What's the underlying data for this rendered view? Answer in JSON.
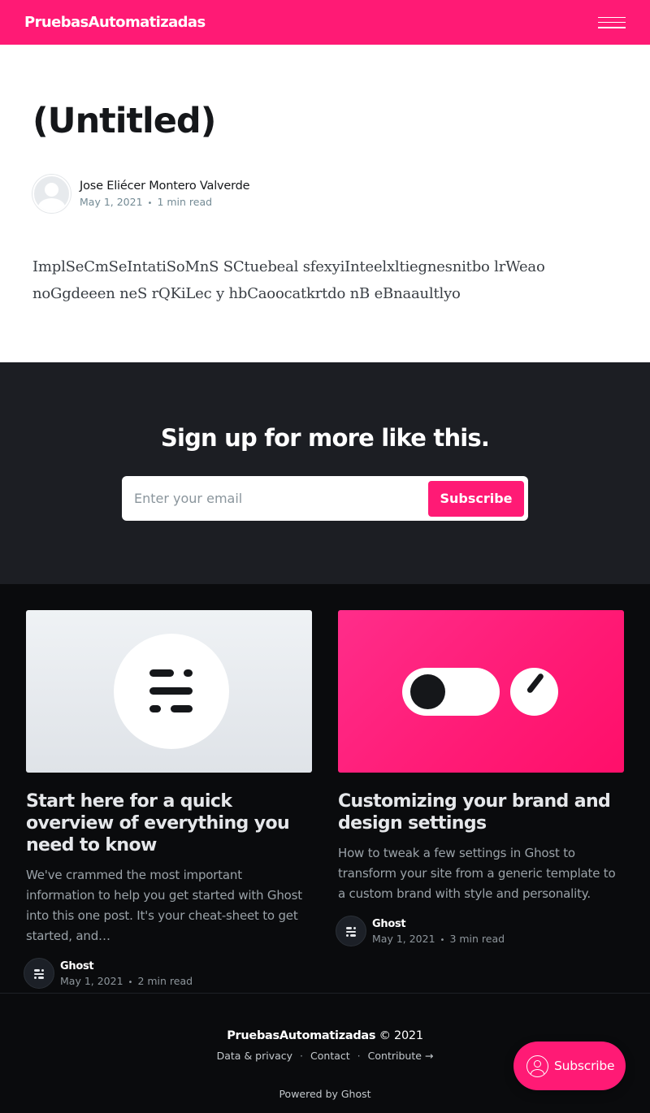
{
  "header": {
    "site_title": "PruebasAutomatizadas",
    "menu_icon": "hamburger-menu-icon"
  },
  "post": {
    "title": "(Untitled)",
    "author": "Jose Eliécer Montero Valverde",
    "date": "May 1, 2021",
    "separator": "•",
    "reading_time": "1 min read",
    "body_line1": "ImplSeCmSeIntatiSoMnS  SCtuebeal sfexyiInteelxltiegnesnitbo lrWeao",
    "body_line2": "noGgdeeen neS rQKiLec y hbCaoocatkrtdo nB eBnaaultlyo"
  },
  "signup": {
    "title": "Sign up for more like this.",
    "email_placeholder": "Enter your email",
    "button_label": "Subscribe"
  },
  "related": [
    {
      "title": "Start here for a quick overview of everything you need to know",
      "excerpt": "We've crammed the most important information to help you get started with Ghost into this one post. It's your cheat-sheet to get started, and…",
      "author": "Ghost",
      "date": "May 1, 2021",
      "reading_time": "2 min read"
    },
    {
      "title": "Customizing your brand and design settings",
      "excerpt": "How to tweak a few settings in Ghost to transform your site from a generic template to a custom brand with style and personality.",
      "author": "Ghost",
      "date": "May 1, 2021",
      "reading_time": "3 min read"
    }
  ],
  "footer": {
    "site_title": "PruebasAutomatizadas",
    "copyright": "© 2021",
    "links": [
      "Data & privacy",
      "Contact",
      "Contribute →"
    ],
    "separator": "·",
    "powered_by": "Powered by Ghost"
  },
  "portal": {
    "button_label": "Subscribe"
  },
  "colors": {
    "accent": "#ff1a75",
    "dark_section": "#1c1e23",
    "footer_bg": "#0a0b0d"
  }
}
